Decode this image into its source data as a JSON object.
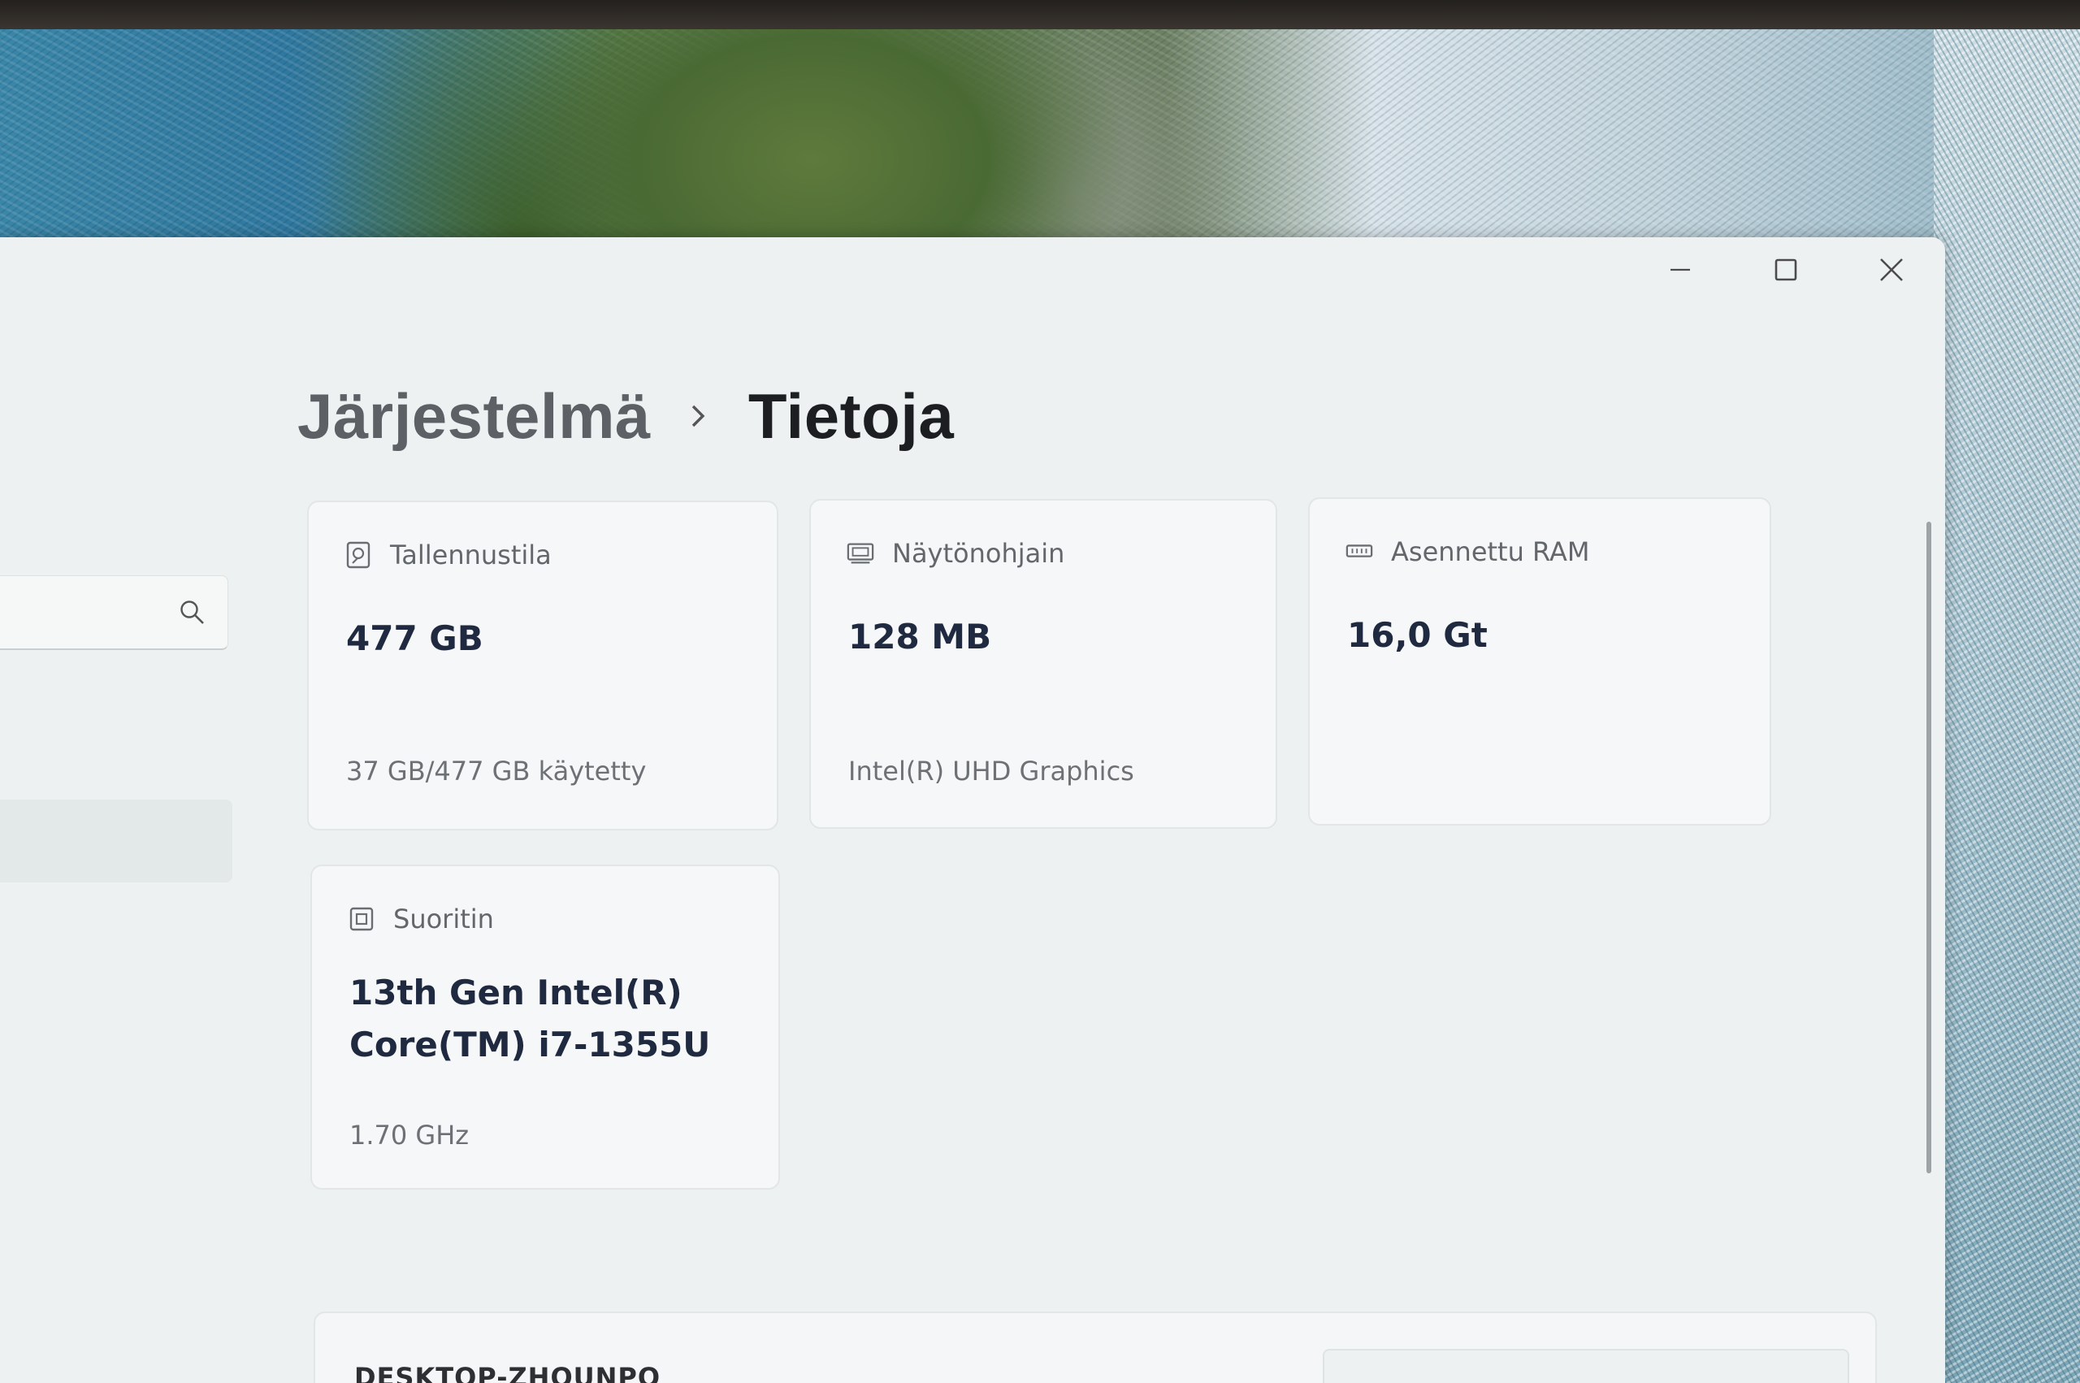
{
  "window": {
    "minimize_label": "Minimize",
    "maximize_label": "Maximize",
    "close_label": "Close"
  },
  "breadcrumb": {
    "parent": "Järjestelmä",
    "current": "Tietoja"
  },
  "cards": {
    "storage": {
      "label": "Tallennustila",
      "value": "477 GB",
      "detail": "37 GB/477 GB käytetty",
      "icon": "storage-drive-icon"
    },
    "graphics": {
      "label": "Näytönohjain",
      "value": "128 MB",
      "detail": "Intel(R) UHD Graphics",
      "icon": "graphics-card-icon"
    },
    "ram": {
      "label": "Asennettu RAM",
      "value": "16,0 Gt",
      "icon": "memory-module-icon"
    },
    "processor": {
      "label": "Suoritin",
      "value_line1": "13th Gen Intel(R)",
      "value_line2": "Core(TM) i7-1355U",
      "detail": "1.70 GHz",
      "icon": "processor-chip-icon"
    }
  },
  "device": {
    "name": "DESKTOP-ZHOUNPO"
  },
  "colors": {
    "window_bg": "#edf1f2",
    "card_bg": "#f5f7f8",
    "value_text": "#1f2a40"
  }
}
